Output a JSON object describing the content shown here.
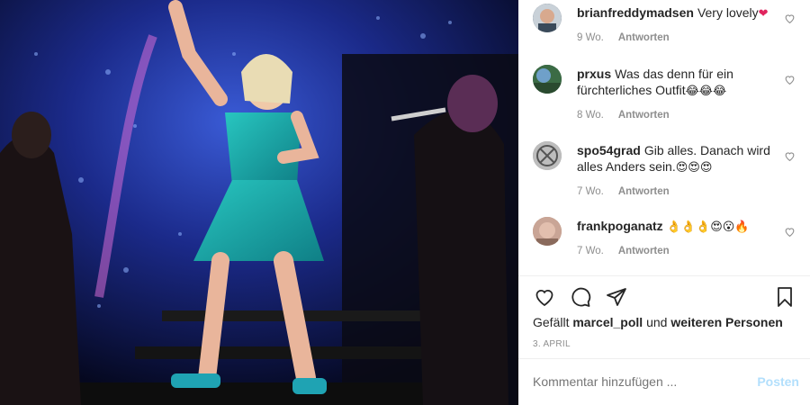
{
  "comments": [
    {
      "user": "brianfreddymadsen",
      "text": "Very lovely",
      "emoji": "❤",
      "age": "9 Wo.",
      "reply": "Antworten",
      "avatar_color": "#5a6b7a"
    },
    {
      "user": "prxus",
      "text": "Was das denn für ein fürchterliches Outfit",
      "emoji": "😂😂😂",
      "age": "8 Wo.",
      "reply": "Antworten",
      "avatar_color": "#2f5a3a"
    },
    {
      "user": "spo54grad",
      "text": "Gib alles. Danach wird alles Anders sein.",
      "emoji": "😍😍😍",
      "age": "7 Wo.",
      "reply": "Antworten",
      "avatar_color": "#9a9a9a"
    },
    {
      "user": "frankpoganatz",
      "text": "",
      "emoji": "👌👌👌😍😮🔥",
      "age": "7 Wo.",
      "reply": "Antworten",
      "avatar_color": "#b58a78"
    }
  ],
  "likes": {
    "prefix": "Gefällt",
    "user": "marcel_poll",
    "conj": "und",
    "others": "weiteren Personen"
  },
  "date": "3. APRIL",
  "composer": {
    "placeholder": "Kommentar hinzufügen ...",
    "post_label": "Posten"
  },
  "icons": {
    "like": "heart-icon",
    "comment": "comment-icon",
    "share": "share-icon",
    "save": "bookmark-icon"
  },
  "colors": {
    "text": "#262626",
    "muted": "#8e8e8e",
    "post_disabled": "#b2dffc"
  }
}
